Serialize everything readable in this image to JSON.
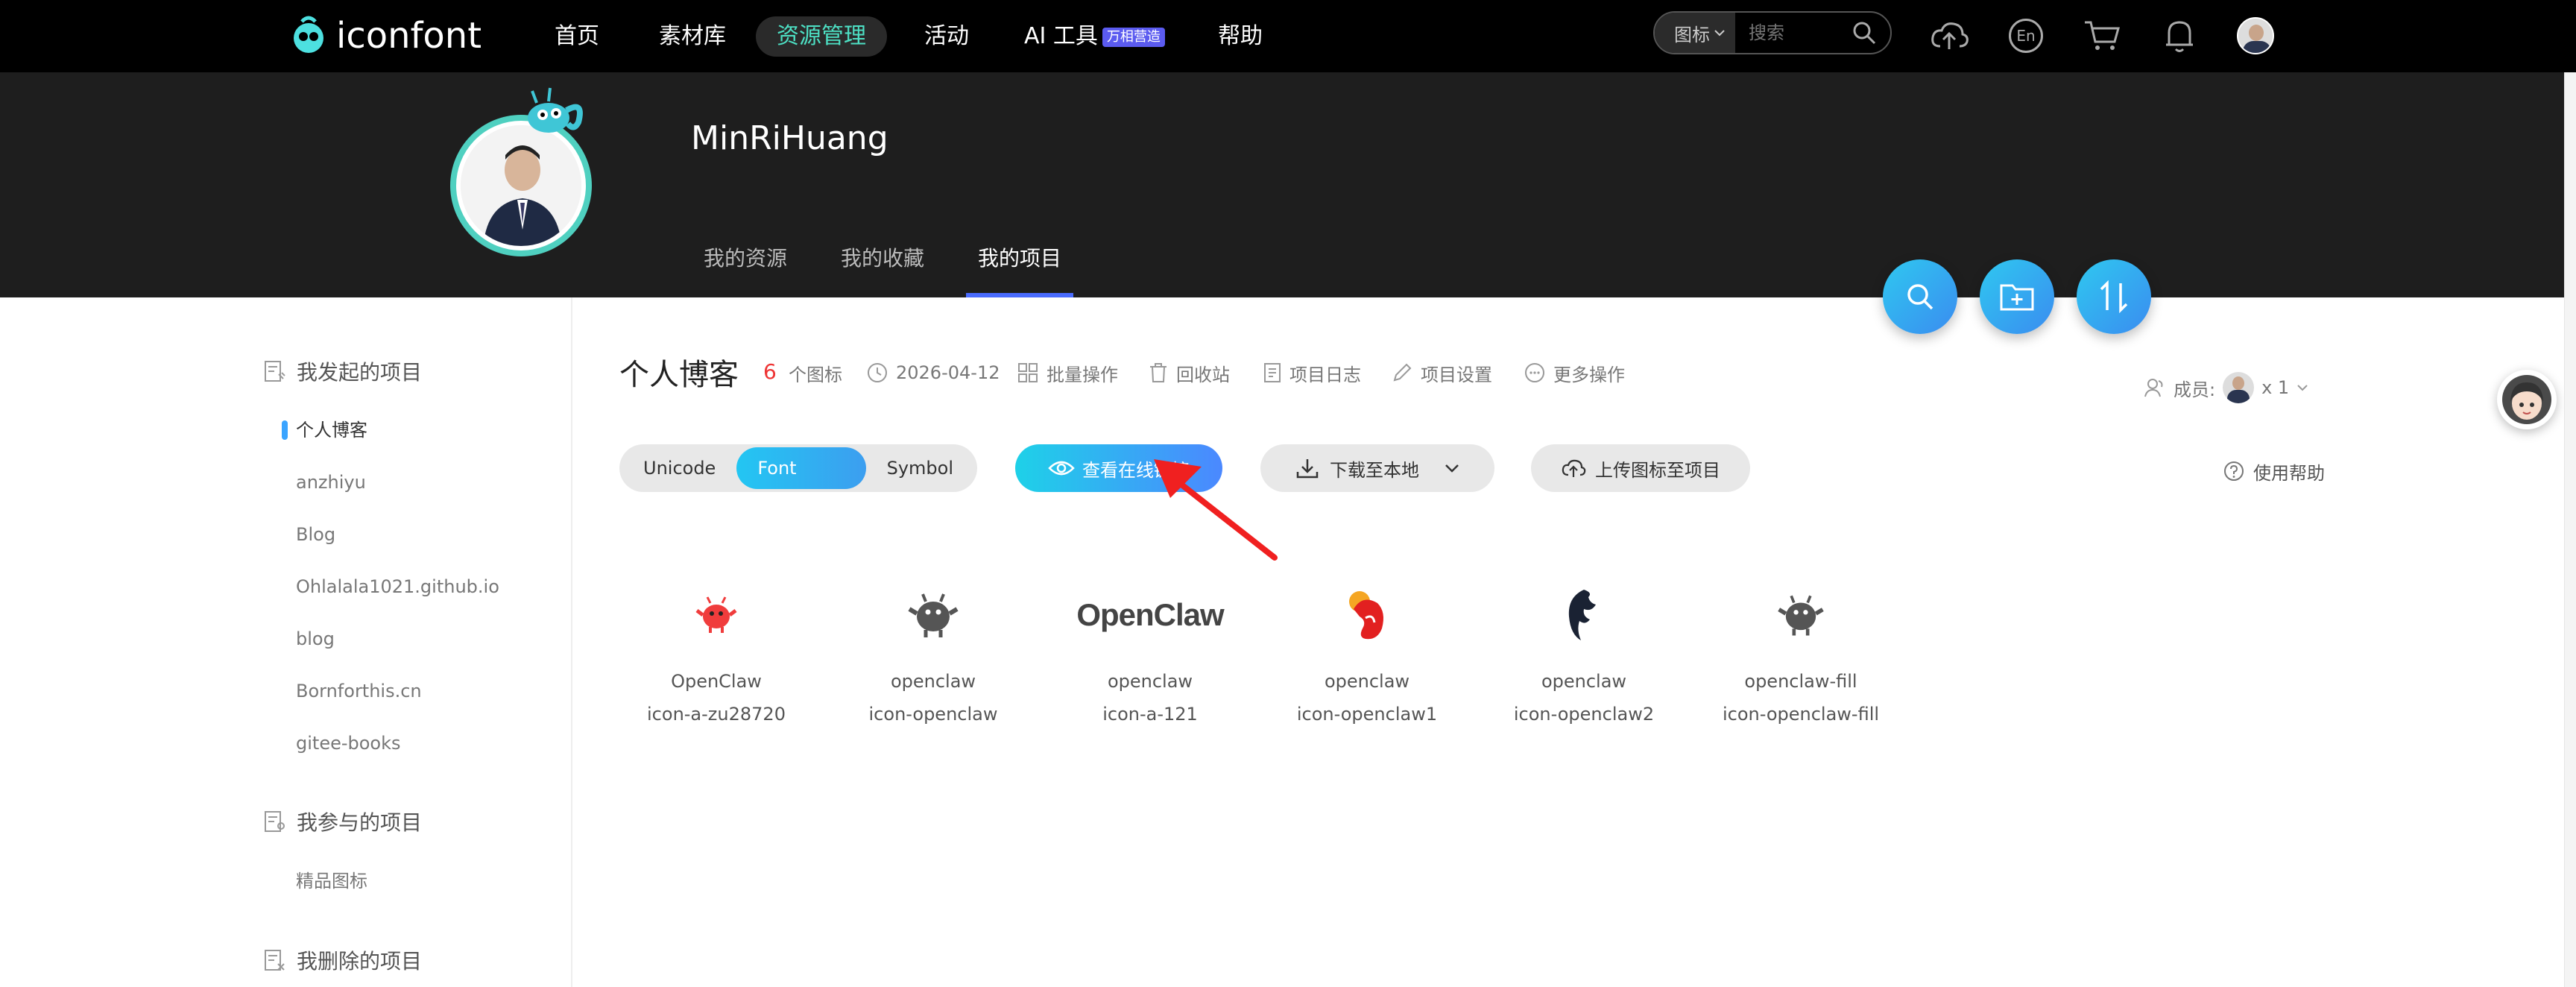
{
  "nav": {
    "logo_text": "iconfont",
    "items": [
      "首页",
      "素材库",
      "资源管理",
      "活动",
      "AI 工具",
      "帮助"
    ],
    "ai_badge": "万相营造",
    "search_type": "图标",
    "search_placeholder": "搜索",
    "lang_icon_text": "En"
  },
  "profile": {
    "username": "MinRiHuang",
    "tabs": [
      "我的资源",
      "我的收藏",
      "我的项目"
    ]
  },
  "sidebar": {
    "sections": [
      {
        "title": "我发起的项目",
        "items": [
          "个人博客",
          "anzhiyu",
          "Blog",
          "Ohlalala1021.github.io",
          "blog",
          "Bornforthis.cn",
          "gitee-books"
        ]
      },
      {
        "title": "我参与的项目",
        "items": [
          "精品图标"
        ]
      },
      {
        "title": "我删除的项目",
        "items": []
      }
    ]
  },
  "project": {
    "title": "个人博客",
    "count": "6",
    "count_label": "个图标",
    "date": "2026-04-12",
    "actions": [
      "批量操作",
      "回收站",
      "项目日志",
      "项目设置",
      "更多操作"
    ],
    "members_label": "成员:",
    "members_count": "x 1"
  },
  "toolbar": {
    "formats": [
      "Unicode",
      "Font class",
      "Symbol"
    ],
    "online_link": "查看在线链接",
    "download": "下载至本地",
    "upload": "上传图标至项目",
    "help": "使用帮助"
  },
  "icons": [
    {
      "name": "OpenClaw",
      "code": "icon-a-zu28720",
      "color": "#f03c3c"
    },
    {
      "name": "openclaw",
      "code": "icon-openclaw",
      "color": "#555555"
    },
    {
      "name": "openclaw",
      "code": "icon-a-121",
      "color": "#444444",
      "wordmark": "OpenClaw"
    },
    {
      "name": "openclaw",
      "code": "icon-openclaw1",
      "color": "#e22020"
    },
    {
      "name": "openclaw",
      "code": "icon-openclaw2",
      "color": "#1a2233"
    },
    {
      "name": "openclaw-fill",
      "code": "icon-openclaw-fill",
      "color": "#555555"
    }
  ]
}
